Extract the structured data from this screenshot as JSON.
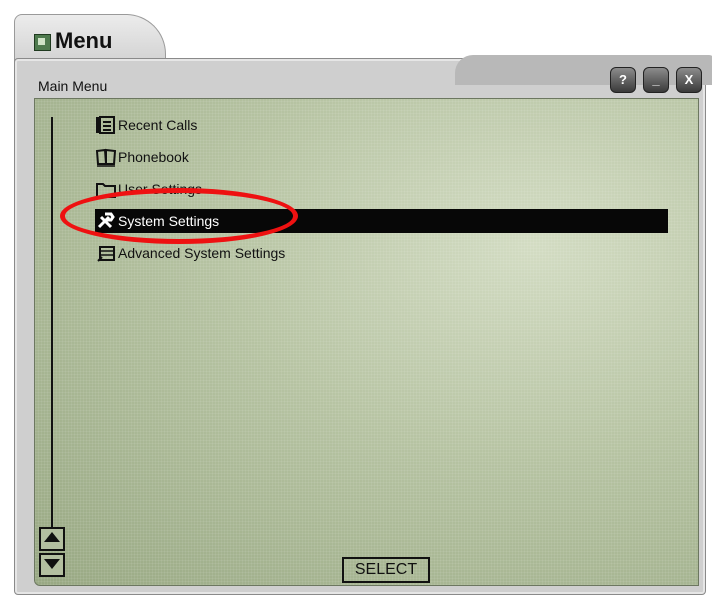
{
  "tab": {
    "title": "Menu",
    "icon": "menu-grid-icon"
  },
  "window": {
    "title": "Main Menu",
    "buttons": [
      {
        "label": "?",
        "icon": "help-icon"
      },
      {
        "label": "_",
        "icon": "minimize-icon"
      },
      {
        "label": "X",
        "icon": "close-icon"
      }
    ]
  },
  "menu": {
    "items": [
      {
        "label": "Recent Calls",
        "icon": "recent-calls-icon",
        "selected": false
      },
      {
        "label": "Phonebook",
        "icon": "phonebook-icon",
        "selected": false
      },
      {
        "label": "User Settings",
        "icon": "folder-icon",
        "selected": false
      },
      {
        "label": "System Settings",
        "icon": "wrench-icon",
        "selected": true
      },
      {
        "label": "Advanced System Settings",
        "icon": "server-icon",
        "selected": false
      }
    ],
    "select_label": "SELECT"
  },
  "colors": {
    "screen": "#b6c3a2",
    "selection": "#070707",
    "annotation": "#e11111"
  }
}
